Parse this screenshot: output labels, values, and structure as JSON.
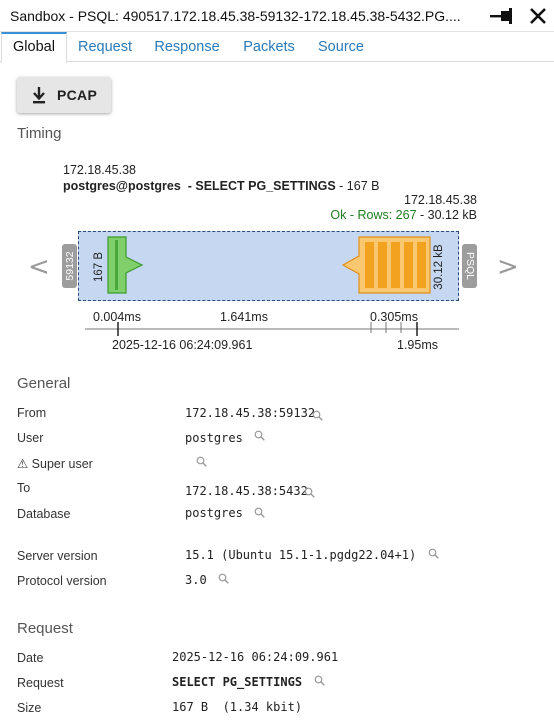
{
  "window": {
    "title": "Sandbox - PSQL: 490517.172.18.45.38-59132-172.18.45.38-5432.PG...."
  },
  "tabs": [
    {
      "label": "Global",
      "active": true
    },
    {
      "label": "Request"
    },
    {
      "label": "Response"
    },
    {
      "label": "Packets"
    },
    {
      "label": "Source"
    }
  ],
  "pcap_button": {
    "label": "PCAP"
  },
  "timing": {
    "section_title": "Timing",
    "client_ip": "172.18.45.38",
    "request_user": "postgres@postgres",
    "request_query": "- SELECT PG_SETTINGS",
    "request_size": "- 167 B",
    "server_ip": "172.18.45.38",
    "response_status": "Ok - Rows: 267",
    "response_size": "- 30.12 kB",
    "client_port": "59132",
    "protocol": "PSQL",
    "request_bytes_label": "167 B",
    "response_bytes_label": "30.12 kB",
    "t_request": "0.004ms",
    "t_wait": "1.641ms",
    "t_response": "0.305ms",
    "start_time": "2025-12-16 06:24:09.961",
    "total_time": "1.95ms",
    "colors": {
      "request": "#7fcf6a",
      "response": "#f2a21e",
      "box": "#c6d8f1"
    }
  },
  "general": {
    "section_title": "General",
    "rows": [
      {
        "key": "From",
        "value": "172.18.45.38:59132"
      },
      {
        "key": "User",
        "value": "postgres"
      },
      {
        "key": "⚠ Super user",
        "value": ""
      },
      {
        "key": "To",
        "value": "172.18.45.38:5432"
      },
      {
        "key": "Database",
        "value": "postgres"
      },
      {
        "key": "Server version",
        "value": "15.1 (Ubuntu 15.1-1.pgdg22.04+1)"
      },
      {
        "key": "Protocol version",
        "value": "3.0"
      }
    ]
  },
  "request": {
    "section_title": "Request",
    "rows": [
      {
        "key": "Date",
        "value": "2025-12-16 06:24:09.961"
      },
      {
        "key": "Request",
        "value": "SELECT PG_SETTINGS"
      },
      {
        "key": "Size",
        "value": "167 B  (1.34 kbit)"
      }
    ]
  }
}
